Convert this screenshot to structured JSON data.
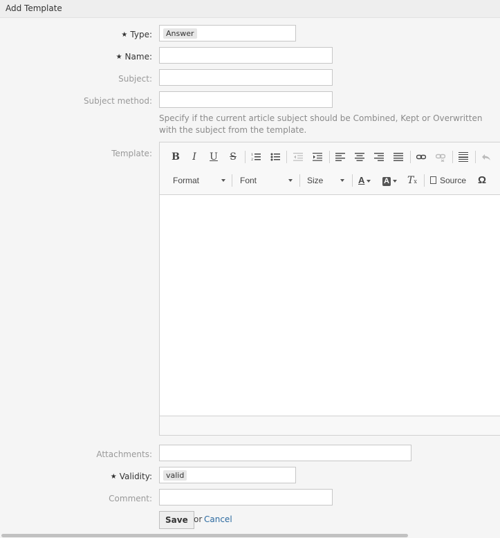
{
  "header": {
    "title": "Add Template"
  },
  "form": {
    "type": {
      "label": "Type:",
      "value": "Answer"
    },
    "name": {
      "label": "Name:",
      "value": ""
    },
    "subject": {
      "label": "Subject:",
      "value": ""
    },
    "subject_method": {
      "label": "Subject method:",
      "value": "",
      "hint": "Specify if the current article subject should be Combined, Kept or Overwritten with the subject from the template."
    },
    "template": {
      "label": "Template:"
    },
    "attachments": {
      "label": "Attachments:"
    },
    "validity": {
      "label": "Validity:",
      "value": "valid"
    },
    "comment": {
      "label": "Comment:",
      "value": ""
    },
    "required_marker": "★"
  },
  "editor": {
    "toolbar": {
      "bold": "B",
      "italic": "I",
      "underline": "U",
      "strike": "S",
      "format_label": "Format",
      "font_label": "Font",
      "size_label": "Size",
      "source_label": "Source",
      "special_char": "Ω"
    }
  },
  "actions": {
    "save_label": "Save",
    "or_text": "or",
    "cancel_label": "Cancel"
  }
}
